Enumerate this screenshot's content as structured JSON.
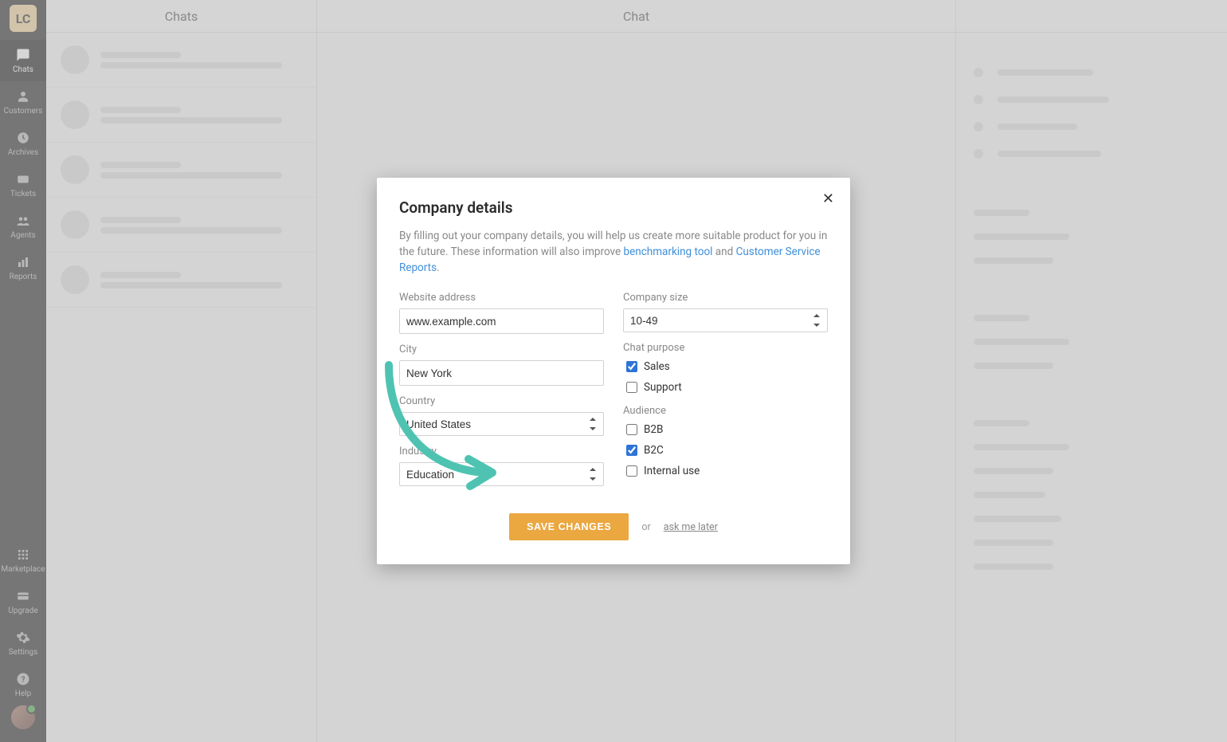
{
  "sidebar": {
    "items": [
      {
        "label": "Chats"
      },
      {
        "label": "Customers"
      },
      {
        "label": "Archives"
      },
      {
        "label": "Tickets"
      },
      {
        "label": "Agents"
      },
      {
        "label": "Reports"
      }
    ],
    "bottom": [
      {
        "label": "Marketplace"
      },
      {
        "label": "Upgrade"
      },
      {
        "label": "Settings"
      },
      {
        "label": "Help"
      }
    ]
  },
  "columns": {
    "left_title": "Chats",
    "mid_title": "Chat"
  },
  "modal": {
    "title": "Company details",
    "desc_before": "By filling out your company details, you will help us create more suitable product for you in the future. These information will also improve ",
    "link1": "benchmarking tool",
    "desc_mid": " and ",
    "link2": "Customer Service Reports",
    "desc_after": ".",
    "left": {
      "website_label": "Website address",
      "website_value": "www.example.com",
      "city_label": "City",
      "city_value": "New York",
      "country_label": "Country",
      "country_value": "United States",
      "industry_label": "Industry",
      "industry_value": "Education"
    },
    "right": {
      "size_label": "Company size",
      "size_value": "10-49",
      "purpose_label": "Chat purpose",
      "purpose_sales": "Sales",
      "purpose_support": "Support",
      "audience_label": "Audience",
      "aud_b2b": "B2B",
      "aud_b2c": "B2C",
      "aud_internal": "Internal use"
    },
    "save": "SAVE CHANGES",
    "or": "or",
    "later": "ask me later"
  }
}
